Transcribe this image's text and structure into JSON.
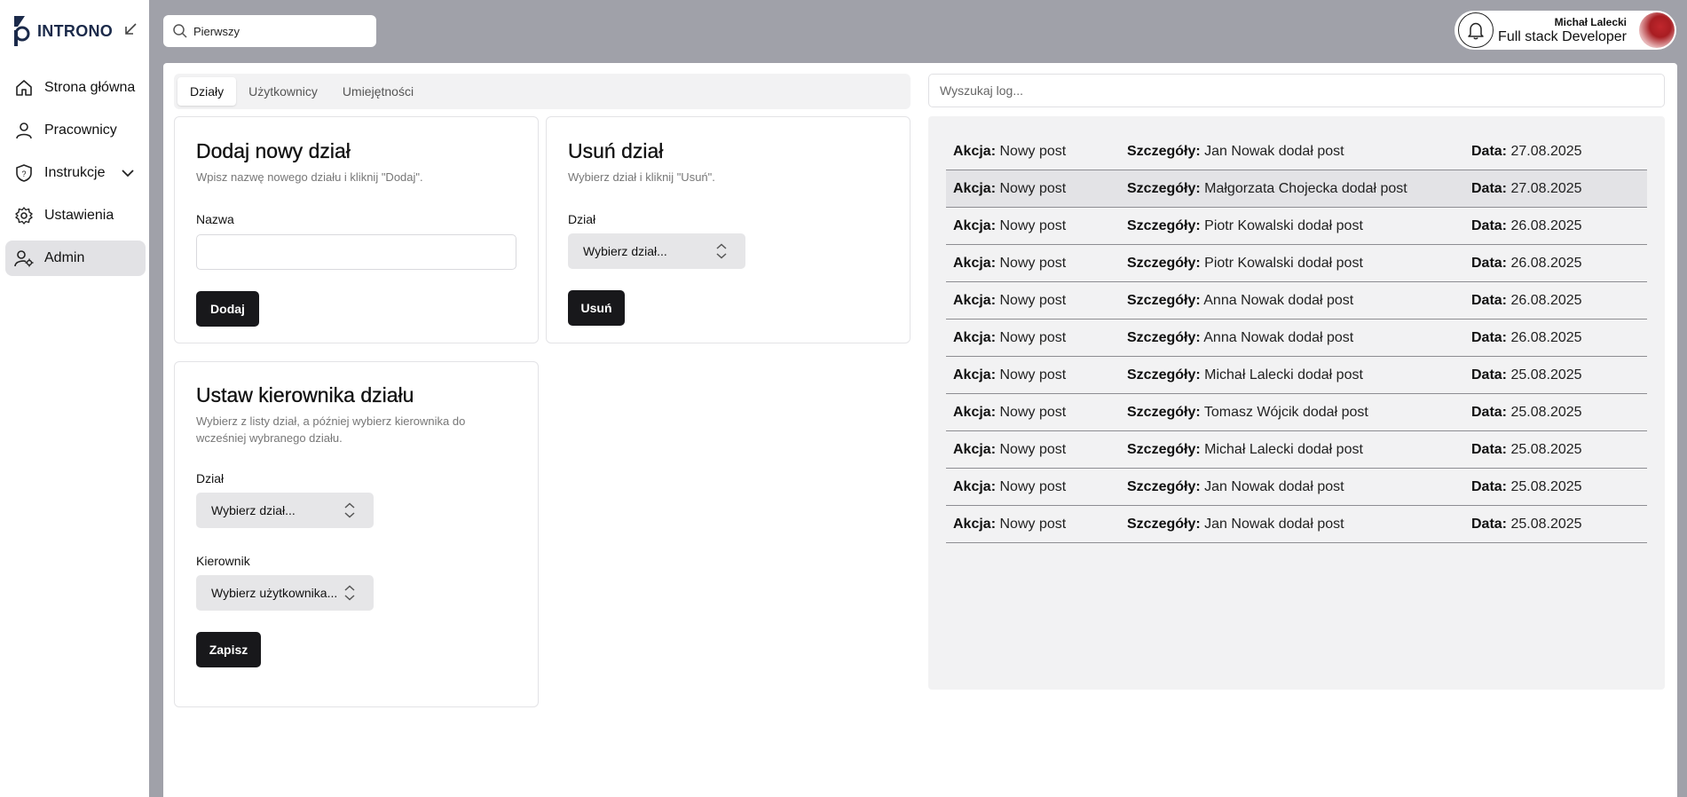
{
  "brand": {
    "name": "INTRONO"
  },
  "sidebar": {
    "items": [
      {
        "label": "Strona główna",
        "icon": "home-icon"
      },
      {
        "label": "Pracownicy",
        "icon": "user-icon"
      },
      {
        "label": "Instrukcje",
        "icon": "shield-icon"
      },
      {
        "label": "Ustawienia",
        "icon": "gear-icon"
      },
      {
        "label": "Admin",
        "icon": "user-cog-icon",
        "active": true
      }
    ]
  },
  "topbar": {
    "search_value": "Pierwszy",
    "user_name": "Michał Lalecki",
    "user_role": "Full stack Developer"
  },
  "tabs": [
    "Działy",
    "Użytkownicy",
    "Umiejętności"
  ],
  "add_dept": {
    "title": "Dodaj nowy dział",
    "desc": "Wpisz nazwę nowego działu i kliknij \"Dodaj\".",
    "field_label": "Nazwa",
    "field_value": "",
    "button": "Dodaj"
  },
  "remove_dept": {
    "title": "Usuń dział",
    "desc": "Wybierz dział i kliknij \"Usuń\".",
    "field_label": "Dział",
    "select_value": "Wybierz dział...",
    "button": "Usuń"
  },
  "set_manager": {
    "title": "Ustaw kierownika działu",
    "desc": "Wybierz z listy dział, a później wybierz kierownika do wcześniej wybranego działu.",
    "dept_label": "Dział",
    "dept_select": "Wybierz dział...",
    "manager_label": "Kierownik",
    "manager_select": "Wybierz użytkownika...",
    "button": "Zapisz"
  },
  "log": {
    "search_placeholder": "Wyszukaj log...",
    "labels": {
      "action": "Akcja:",
      "details": "Szczegóły:",
      "date": "Data:"
    },
    "rows": [
      {
        "action": "Nowy post",
        "details": "Jan Nowak dodał post",
        "date": "27.08.2025"
      },
      {
        "action": "Nowy post",
        "details": "Małgorzata Chojecka dodał post",
        "date": "27.08.2025"
      },
      {
        "action": "Nowy post",
        "details": "Piotr Kowalski dodał post",
        "date": "26.08.2025"
      },
      {
        "action": "Nowy post",
        "details": "Piotr Kowalski dodał post",
        "date": "26.08.2025"
      },
      {
        "action": "Nowy post",
        "details": "Anna Nowak dodał post",
        "date": "26.08.2025"
      },
      {
        "action": "Nowy post",
        "details": "Anna Nowak dodał post",
        "date": "26.08.2025"
      },
      {
        "action": "Nowy post",
        "details": "Michał Lalecki dodał post",
        "date": "25.08.2025"
      },
      {
        "action": "Nowy post",
        "details": "Tomasz Wójcik dodał post",
        "date": "25.08.2025"
      },
      {
        "action": "Nowy post",
        "details": "Michał Lalecki dodał post",
        "date": "25.08.2025"
      },
      {
        "action": "Nowy post",
        "details": "Jan Nowak dodał post",
        "date": "25.08.2025"
      },
      {
        "action": "Nowy post",
        "details": "Jan Nowak dodał post",
        "date": "25.08.2025"
      }
    ]
  },
  "colors": {
    "accent": "#18181b",
    "brand": "#1b2a4a",
    "background": "#a0a1a9"
  }
}
